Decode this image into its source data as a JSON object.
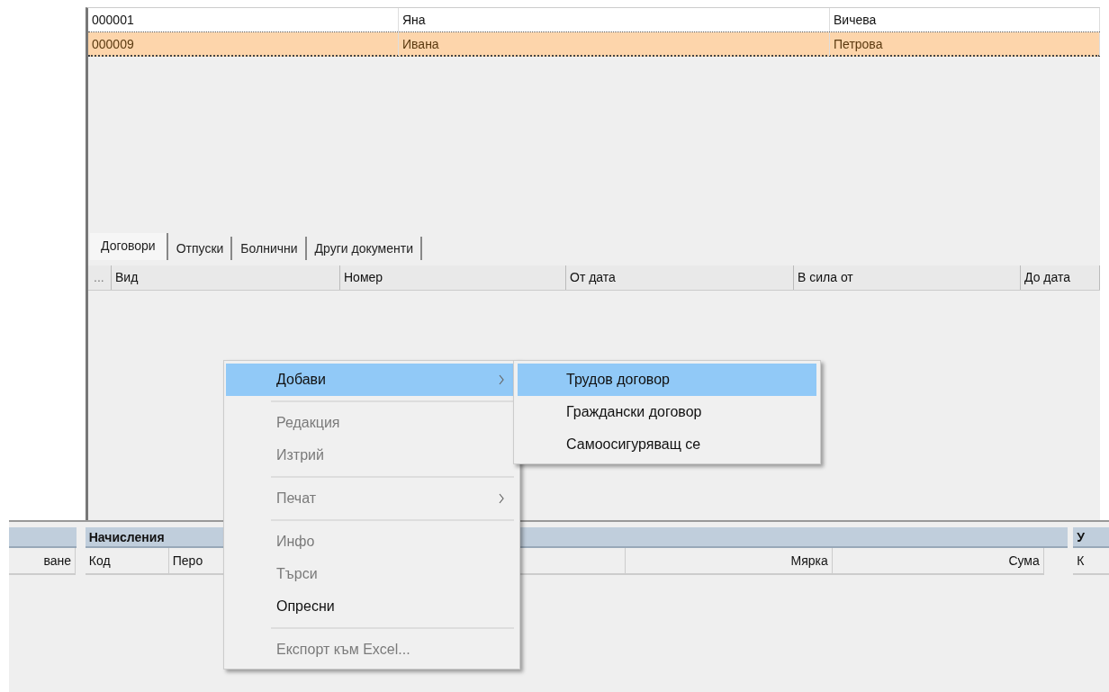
{
  "employees": {
    "rows": [
      {
        "cells": [
          "000001",
          "Яна",
          "Вичева"
        ],
        "selected": false
      },
      {
        "cells": [
          "000009",
          "Ивана",
          "Петрова"
        ],
        "selected": true
      }
    ]
  },
  "tabs": [
    {
      "label": "Договори",
      "selected": true
    },
    {
      "label": "Отпуски",
      "selected": false
    },
    {
      "label": "Болнични",
      "selected": false
    },
    {
      "label": "Други документи",
      "selected": false
    }
  ],
  "documents_grid": {
    "columns": [
      "...",
      "Вид",
      "Номер",
      "От дата",
      "В сила от",
      "До дата"
    ]
  },
  "left_group": {
    "columns": [
      "ване"
    ]
  },
  "accruals": {
    "title": "Начисления",
    "columns": [
      "Код",
      "Перо",
      "Мярка",
      "Сума"
    ]
  },
  "deductions": {
    "title": "У",
    "columns": [
      "К"
    ]
  },
  "context_menu": {
    "items": [
      {
        "kind": "item",
        "label": "Добави",
        "disabled": false,
        "selected": true,
        "submenu": true
      },
      {
        "kind": "separator"
      },
      {
        "kind": "item",
        "label": "Редакция",
        "disabled": true,
        "selected": false,
        "submenu": false
      },
      {
        "kind": "item",
        "label": "Изтрий",
        "disabled": true,
        "selected": false,
        "submenu": false
      },
      {
        "kind": "separator"
      },
      {
        "kind": "item",
        "label": "Печат",
        "disabled": true,
        "selected": false,
        "submenu": true
      },
      {
        "kind": "separator"
      },
      {
        "kind": "item",
        "label": "Инфо",
        "disabled": true,
        "selected": false,
        "submenu": false
      },
      {
        "kind": "item",
        "label": "Търси",
        "disabled": true,
        "selected": false,
        "submenu": false
      },
      {
        "kind": "item",
        "label": "Опресни",
        "disabled": false,
        "selected": false,
        "submenu": false
      },
      {
        "kind": "separator"
      },
      {
        "kind": "item",
        "label": "Експорт към Excel...",
        "disabled": true,
        "selected": false,
        "submenu": false
      }
    ]
  },
  "submenu": {
    "items": [
      {
        "label": "Трудов договор",
        "selected": true
      },
      {
        "label": "Граждански договор",
        "selected": false
      },
      {
        "label": "Самоосигуряващ се",
        "selected": false
      }
    ]
  }
}
